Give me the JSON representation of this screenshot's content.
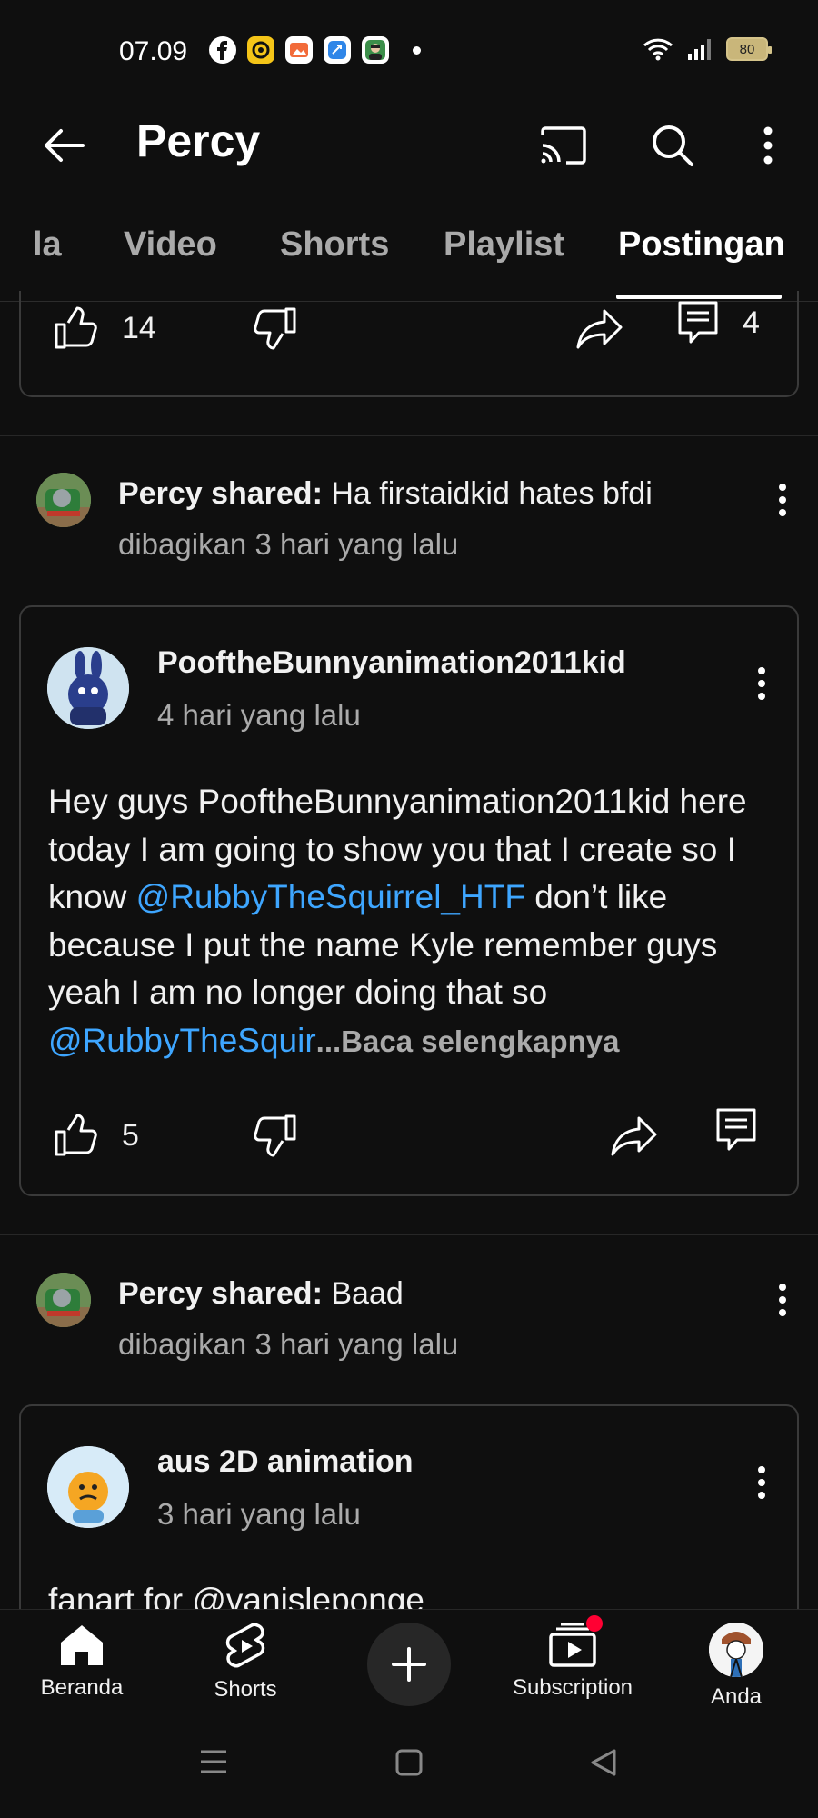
{
  "status_bar": {
    "time": "07.09",
    "battery": "80",
    "apps": [
      "facebook-icon",
      "app-icon-yellow",
      "app-icon-orange",
      "app-icon-blue",
      "app-icon-avatar"
    ]
  },
  "app_bar": {
    "title": "Percy",
    "icons": [
      "back-arrow-icon",
      "cast-icon",
      "search-icon",
      "more-vert-icon"
    ]
  },
  "tabs": [
    {
      "label": "la",
      "active": false
    },
    {
      "label": "Video",
      "active": false
    },
    {
      "label": "Shorts",
      "active": false
    },
    {
      "label": "Playlist",
      "active": false
    },
    {
      "label": "Postingan",
      "active": true
    }
  ],
  "top_card": {
    "likes": "14",
    "comments": "4"
  },
  "posts": [
    {
      "shared_by": "Percy shared:",
      "shared_text": "Ha firstaidkid hates bfdi",
      "shared_time": "dibagikan 3 hari yang lalu",
      "author": "PooftheBunnyanimation2011kid",
      "time": "4 hari yang lalu",
      "body_1": "Hey guys PooftheBunnyanimation2011kid here today I am going to show you that I create so I know ",
      "mention_1": "@RubbyTheSquirrel_HTF",
      "body_2": " don’t like because I put the name Kyle remember guys yeah I am no longer doing that so ",
      "mention_2": "@RubbyTheSquir",
      "read_more": "...Baca selengkapnya",
      "likes": "5"
    },
    {
      "shared_by": "Percy shared:",
      "shared_text": "Baad",
      "shared_time": "dibagikan 3 hari yang lalu",
      "author": "aus 2D animation",
      "time": "3 hari yang lalu",
      "body_1": "fanart for ",
      "mention_1": "@vanisleponge"
    }
  ],
  "bottom_nav": {
    "items": [
      {
        "label": "Beranda",
        "icon": "home-icon"
      },
      {
        "label": "Shorts",
        "icon": "shorts-icon"
      },
      {
        "label": "Subscription",
        "icon": "subscriptions-icon"
      },
      {
        "label": "Anda",
        "icon": "account-avatar"
      }
    ],
    "create_icon": "plus-icon"
  },
  "system_nav": [
    "menu-icon",
    "home-square-icon",
    "back-triangle-icon"
  ],
  "colors": {
    "background": "#0f0f0f",
    "text": "#f1f1f1",
    "secondary_text": "#aaaaaa",
    "mention": "#3ea6ff",
    "card_border": "#3a3a3a",
    "notification_dot": "#ff0033"
  }
}
